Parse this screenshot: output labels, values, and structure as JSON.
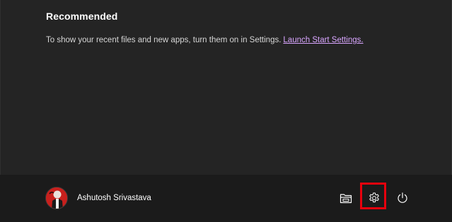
{
  "recommended": {
    "title": "Recommended",
    "message": "To show your recent files and new apps, turn them on in Settings.",
    "link_label": "Launch Start Settings."
  },
  "footer": {
    "user_name": "Ashutosh Srivastava",
    "icons": [
      "file-explorer-icon",
      "settings-gear-icon",
      "power-icon"
    ]
  },
  "colors": {
    "panel_bg": "#242424",
    "footer_bg": "#1b1b1b",
    "link": "#d9a6ff",
    "highlight": "#e8000d"
  }
}
